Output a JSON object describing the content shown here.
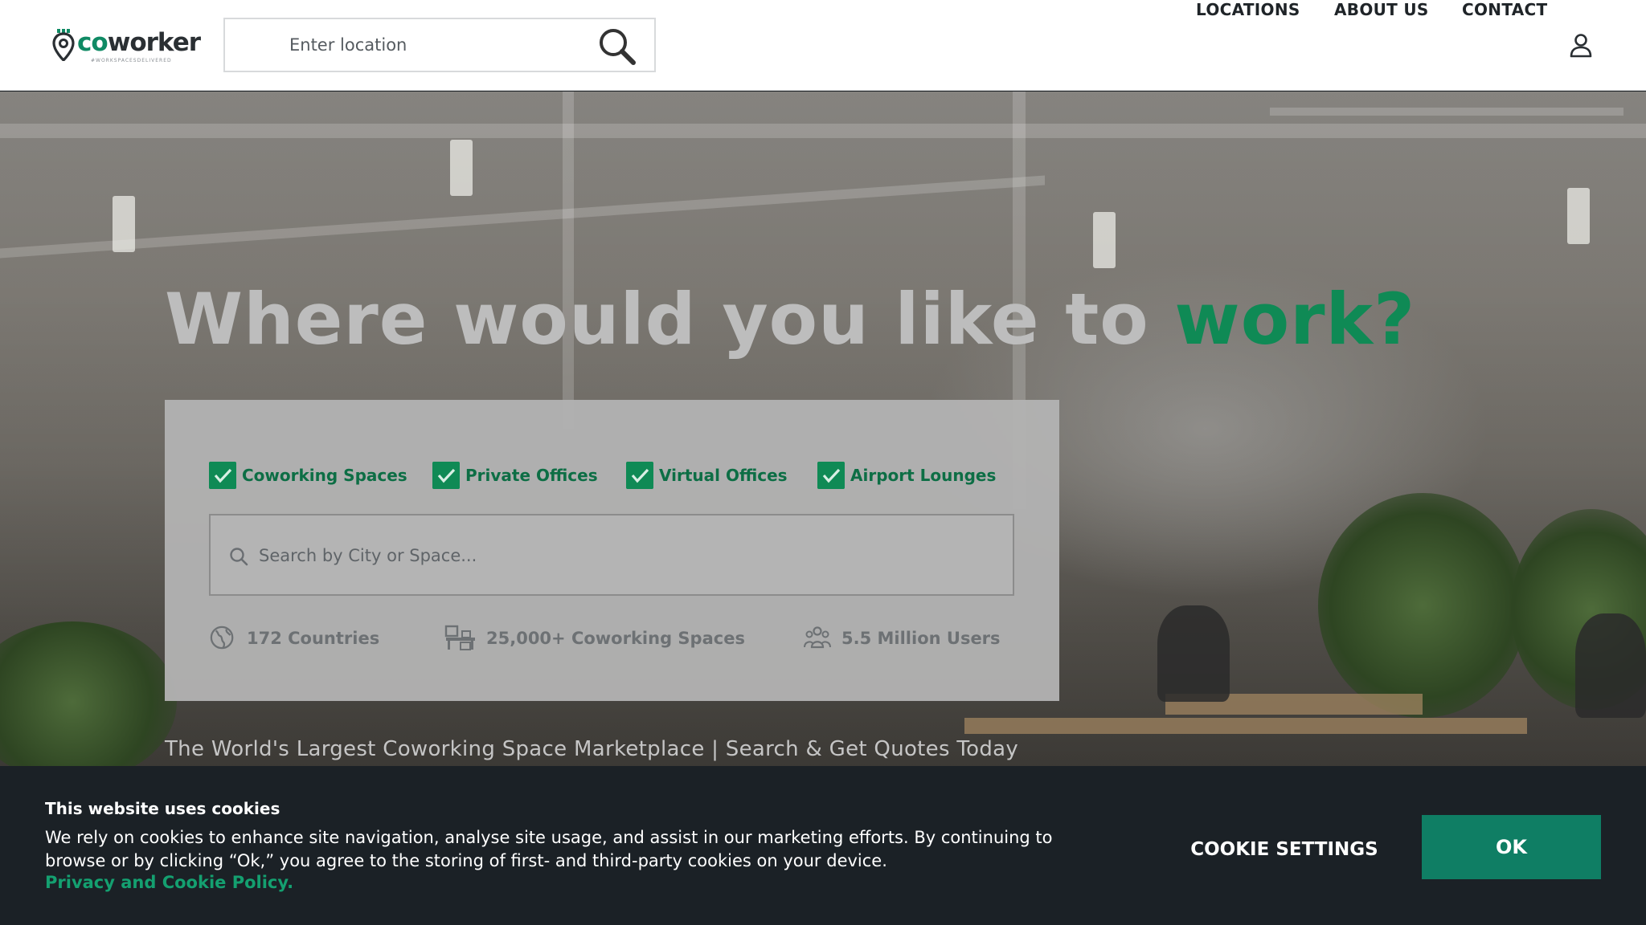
{
  "header": {
    "logo_text_co": "co",
    "logo_text_rest": "worker",
    "logo_tagline": "#WORKSPACESDELIVERED",
    "location_search": {
      "placeholder": "Enter location",
      "value": ""
    },
    "nav": [
      {
        "label": "LOCATIONS"
      },
      {
        "label": "ABOUT US"
      },
      {
        "label": "CONTACT"
      }
    ]
  },
  "hero": {
    "headline_main": "Where would you like to ",
    "headline_accent": "work?",
    "filters": [
      {
        "label": "Coworking Spaces",
        "checked": true
      },
      {
        "label": "Private Offices",
        "checked": true
      },
      {
        "label": "Virtual Offices",
        "checked": true
      },
      {
        "label": "Airport Lounges",
        "checked": true
      }
    ],
    "city_search": {
      "placeholder": "Search by City or Space...",
      "value": ""
    },
    "stats": [
      {
        "icon": "globe-icon",
        "text": "172 Countries"
      },
      {
        "icon": "office-desk-icon",
        "text": "25,000+ Coworking Spaces"
      },
      {
        "icon": "users-group-icon",
        "text": "5.5 Million Users"
      }
    ],
    "tagline": "The World's Largest Coworking Space Marketplace | Search & Get Quotes Today"
  },
  "cookie_banner": {
    "title": "This website uses cookies",
    "body": "We rely on cookies to enhance site navigation, analyse site usage, and assist in our marketing efforts. By continuing to browse or by clicking “Ok,” you agree to the storing of first- and third-party cookies on your device.",
    "policy_link": "Privacy and Cookie Policy.",
    "settings_label": "COOKIE SETTINGS",
    "ok_label": "OK"
  },
  "colors": {
    "brand_green": "#0f8a55",
    "ok_button": "#0f7e64",
    "banner_bg": "#1b2126"
  }
}
